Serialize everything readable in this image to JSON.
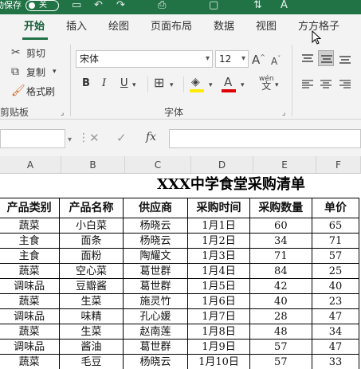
{
  "titlebar": {
    "autosave_label": "动保存",
    "toggle_label": "关",
    "quick_access_icons": [
      "save-icon",
      "undo-icon",
      "redo-icon",
      "print-icon",
      "open-icon",
      "sort-icon",
      "font-color-icon"
    ]
  },
  "tabs": [
    {
      "label": "开始",
      "active": true
    },
    {
      "label": "插入",
      "active": false
    },
    {
      "label": "绘图",
      "active": false
    },
    {
      "label": "页面布局",
      "active": false
    },
    {
      "label": "数据",
      "active": false
    },
    {
      "label": "视图",
      "active": false
    },
    {
      "label": "方方格子",
      "active": false
    }
  ],
  "ribbon": {
    "clipboard": {
      "cut": "剪切",
      "copy": "复制",
      "format_painter": "格式刷",
      "group_label": "剪贴板"
    },
    "font": {
      "font_name": "宋体",
      "font_size": "12",
      "bold": "B",
      "italic": "I",
      "underline": "U",
      "group_label": "字体"
    }
  },
  "formula_bar": {
    "cancel": "✕",
    "enter": "✓",
    "fx": "fx",
    "value": ""
  },
  "columns": [
    "A",
    "B",
    "C",
    "D",
    "E",
    "F"
  ],
  "sheet": {
    "title": "XXX中学食堂采购清单",
    "headers": [
      "产品类别",
      "产品名称",
      "供应商",
      "采购时间",
      "采购数量",
      "单价"
    ],
    "rows": [
      [
        "蔬菜",
        "小白菜",
        "杨晓云",
        "1月1日",
        "60",
        "65"
      ],
      [
        "主食",
        "面条",
        "杨晓云",
        "1月2日",
        "34",
        "71"
      ],
      [
        "主食",
        "面粉",
        "陶耀文",
        "1月3日",
        "71",
        "57"
      ],
      [
        "蔬菜",
        "空心菜",
        "葛世群",
        "1月4日",
        "84",
        "25"
      ],
      [
        "调味品",
        "豆瓣酱",
        "葛世群",
        "1月5日",
        "42",
        "40"
      ],
      [
        "蔬菜",
        "生菜",
        "施灵竹",
        "1月6日",
        "40",
        "23"
      ],
      [
        "调味品",
        "味精",
        "孔心媛",
        "1月7日",
        "28",
        "47"
      ],
      [
        "蔬菜",
        "生菜",
        "赵南莲",
        "1月8日",
        "48",
        "34"
      ],
      [
        "调味品",
        "酱油",
        "葛世群",
        "1月9日",
        "57",
        "47"
      ],
      [
        "蔬菜",
        "毛豆",
        "杨晓云",
        "1月10日",
        "57",
        "33"
      ]
    ]
  }
}
